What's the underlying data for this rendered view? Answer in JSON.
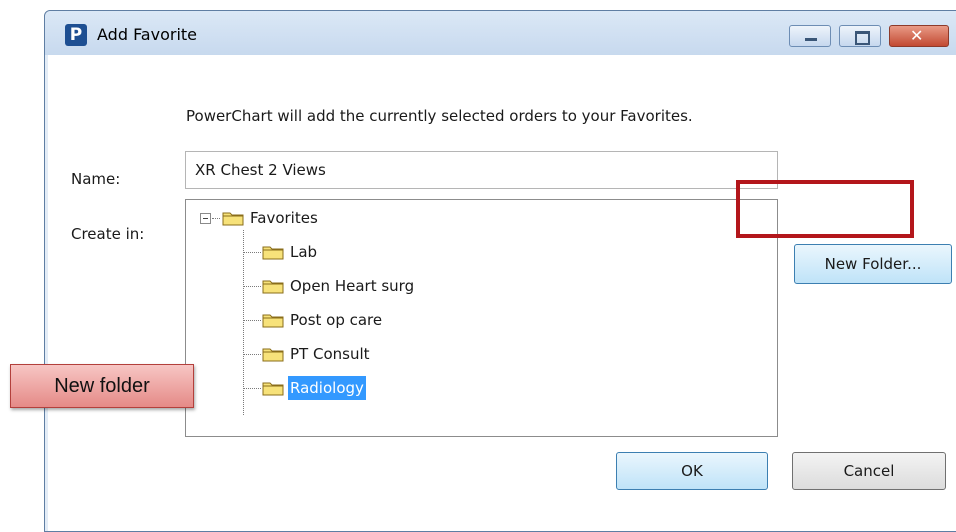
{
  "window": {
    "title": "Add Favorite",
    "app_icon_letter": "P"
  },
  "dialog": {
    "info_text": "PowerChart will add the currently selected orders to your Favorites.",
    "name_label": "Name:",
    "name_value": "XR Chest 2 Views",
    "create_in_label": "Create in:",
    "tree": {
      "root": "Favorites",
      "items": [
        "Lab",
        "Open Heart surg",
        "Post op care",
        "PT Consult",
        "Radiology"
      ],
      "selected": "Radiology"
    },
    "buttons": {
      "new_folder": "New Folder...",
      "ok": "OK",
      "cancel": "Cancel"
    }
  },
  "annotation": {
    "callout_text": "New folder",
    "highlight_color": "#b3161b"
  },
  "colors": {
    "selection": "#3399ff",
    "folder": "#f7e27a"
  }
}
